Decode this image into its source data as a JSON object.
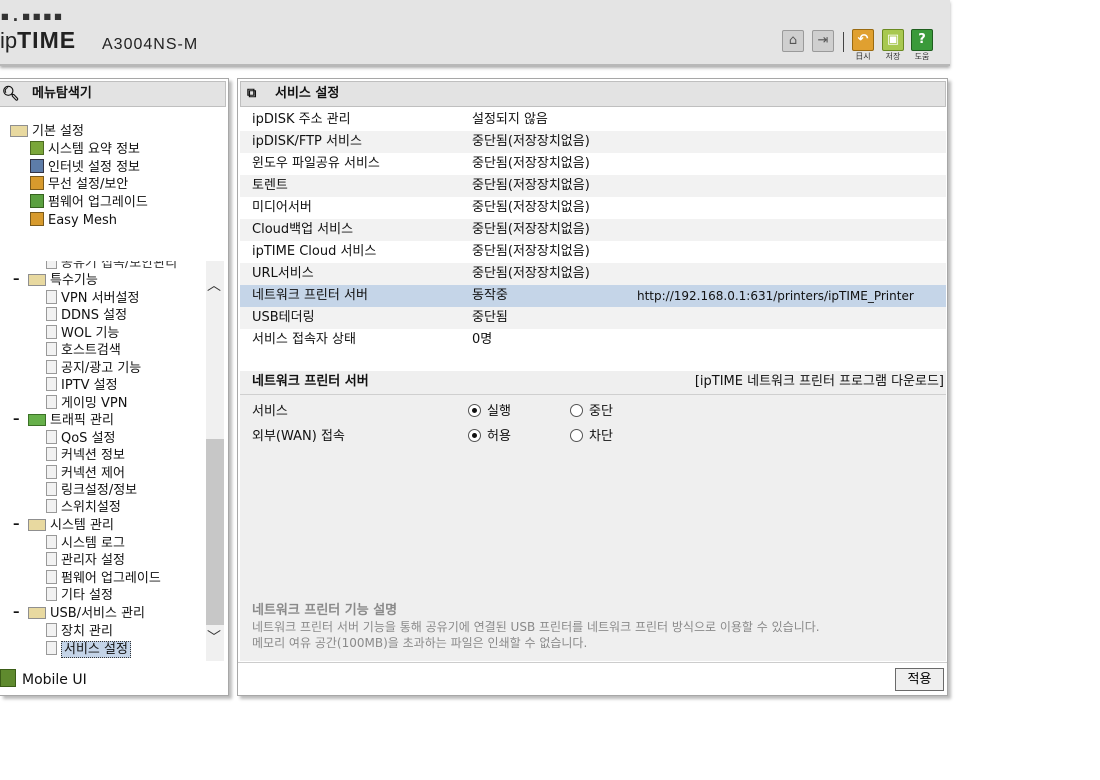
{
  "header": {
    "logo_dots": "▪.▪▪▪▪",
    "brand_plain": "ip",
    "brand_bold": "TIME",
    "model": "A3004NS-M",
    "home_icon": "house-icon",
    "logout_icon": "exit-icon",
    "buttons": [
      {
        "label": "日시",
        "icon": "undo-icon",
        "color": "#e0a030",
        "glyph": "↶"
      },
      {
        "label": "저장",
        "icon": "save-icon",
        "color": "#a8c850",
        "glyph": "▣"
      },
      {
        "label": "도움",
        "icon": "help-icon",
        "color": "#3a9a3a",
        "glyph": "?"
      }
    ]
  },
  "menu": {
    "title": "메뉴탐색기",
    "top_items": {
      "basic": "기본 설정",
      "sys_summary": "시스템 요약 정보",
      "internet": "인터넷 설정 정보",
      "wireless": "무선 설정/보안",
      "firmware": "펌웨어 업그레이드",
      "easymesh": "Easy Mesh"
    },
    "partial_item": "공유기 접속/보안관리",
    "special": "특수기능",
    "special_items": [
      "VPN 서버설정",
      "DDNS 설정",
      "WOL 기능",
      "호스트검색",
      "공지/광고 기능",
      "IPTV 설정",
      "게이밍 VPN"
    ],
    "traffic": "트래픽 관리",
    "traffic_items": [
      "QoS 설정",
      "커넥션 정보",
      "커넥션 제어",
      "링크설정/정보",
      "스위치설정"
    ],
    "system": "시스템 관리",
    "system_items": [
      "시스템 로그",
      "관리자 설정",
      "펌웨어 업그레이드",
      "기타 설정"
    ],
    "usb": "USB/서비스 관리",
    "usb_items": [
      "장치 관리",
      "서비스 설정"
    ],
    "mobile": "Mobile UI"
  },
  "main": {
    "title": "서비스 설정",
    "services": [
      {
        "name": "ipDISK 주소 관리",
        "status": "설정되지 않음",
        "extra": ""
      },
      {
        "name": "ipDISK/FTP 서비스",
        "status": "중단됨(저장장치없음)",
        "extra": ""
      },
      {
        "name": "윈도우 파일공유 서비스",
        "status": "중단됨(저장장치없음)",
        "extra": ""
      },
      {
        "name": "토렌트",
        "status": "중단됨(저장장치없음)",
        "extra": ""
      },
      {
        "name": "미디어서버",
        "status": "중단됨(저장장치없음)",
        "extra": ""
      },
      {
        "name": "Cloud백업 서비스",
        "status": "중단됨(저장장치없음)",
        "extra": ""
      },
      {
        "name": "ipTIME Cloud 서비스",
        "status": "중단됨(저장장치없음)",
        "extra": ""
      },
      {
        "name": "URL서비스",
        "status": "중단됨(저장장치없음)",
        "extra": ""
      },
      {
        "name": "네트워크 프린터 서버",
        "status": "동작중",
        "extra": "http://192.168.0.1:631/printers/ipTIME_Printer"
      },
      {
        "name": "USB테더링",
        "status": "중단됨",
        "extra": ""
      },
      {
        "name": "서비스 접속자 상태",
        "status": "0명",
        "extra": ""
      }
    ],
    "printer_section": {
      "title": "네트워크 프린터 서버",
      "download_link": "[ipTIME 네트워크 프린터 프로그램 다운로드]",
      "service_label": "서비스",
      "service_options": [
        "실행",
        "중단"
      ],
      "service_selected": "실행",
      "wan_label": "외부(WAN) 접속",
      "wan_options": [
        "허용",
        "차단"
      ],
      "wan_selected": "허용"
    },
    "description": {
      "title": "네트워크 프린터 기능 설명",
      "line1": "네트워크 프린터 서버 기능을 통해 공유기에 연결된 USB 프린터를 네트워크 프린터 방식으로 이용할 수 있습니다.",
      "line2": "메모리 여유 공간(100MB)을 초과하는 파일은 인쇄할 수 없습니다."
    },
    "apply_label": "적용"
  }
}
